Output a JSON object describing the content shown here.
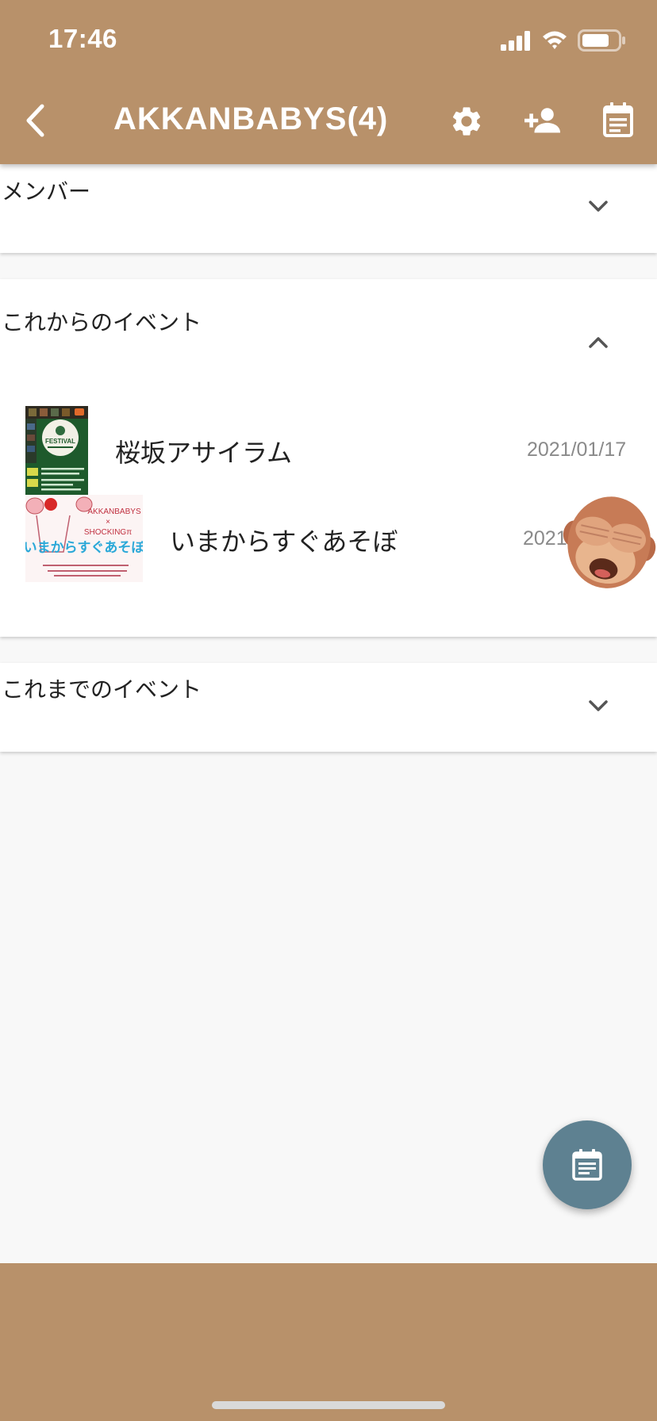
{
  "status_bar": {
    "time": "17:46",
    "icons": [
      "signal-icon",
      "wifi-icon",
      "battery-icon"
    ]
  },
  "app_bar": {
    "title": "AKKANBABYS(4)",
    "back_icon": "back-icon",
    "actions": [
      "settings-icon",
      "add-member-icon",
      "calendar-icon"
    ]
  },
  "sections": {
    "members": {
      "title": "メンバー",
      "expanded": false
    },
    "upcoming": {
      "title": "これからのイベント",
      "expanded": true,
      "events": [
        {
          "name": "桜坂アサイラム",
          "date": "2021/01/17"
        },
        {
          "name": "いまからすぐあそぼ",
          "date": "2021"
        }
      ]
    },
    "past": {
      "title": "これまでのイベント",
      "expanded": false
    }
  },
  "poster_text": {
    "festival": "FESTIVAL",
    "akkanbabys": "AKKANBABYS",
    "x": "×",
    "shocking": "SHOCKINGπ",
    "imakara": "いまからすぐあそぼ"
  },
  "colors": {
    "app_bar": "#b8916a",
    "fab": "#5e8191",
    "background": "#f8f8f8"
  },
  "fab": {
    "icon": "calendar-icon"
  }
}
